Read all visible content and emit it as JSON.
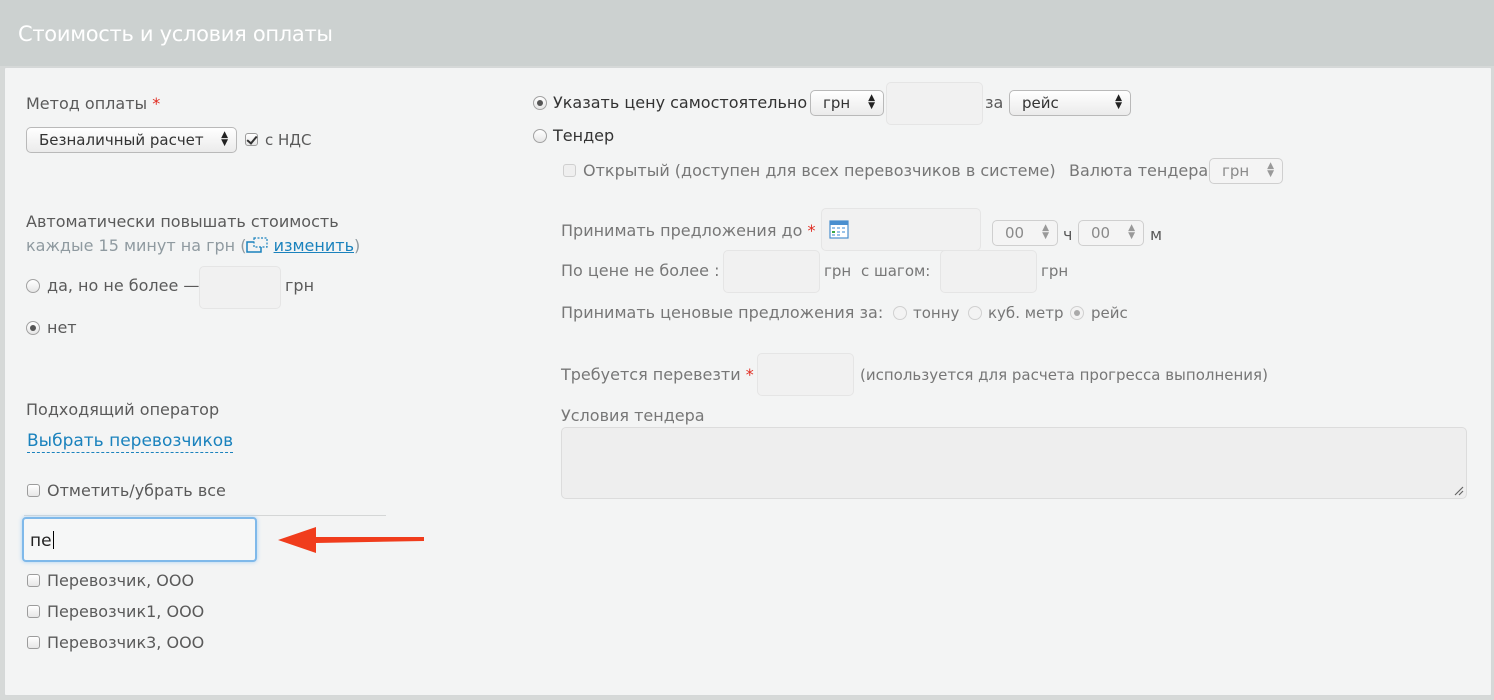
{
  "header": {
    "title": "Стоимость и условия оплаты"
  },
  "payment": {
    "method_label": "Метод оплаты",
    "required_mark": "*",
    "method_value": "Безналичный расчет",
    "vat_label": "с НДС",
    "vat_checked": true
  },
  "auto_raise": {
    "title": "Автоматически повышать стоимость",
    "subtitle_prefix": "каждые 15 минут на грн (",
    "change_link": "изменить",
    "subtitle_suffix": ")",
    "option_yes_label": "да, но не более —",
    "option_yes_unit": "грн",
    "option_no_label": "нет",
    "selected": "no"
  },
  "operator": {
    "title": "Подходящий оператор",
    "choose_link": "Выбрать перевозчиков",
    "toggle_all_label": "Отметить/убрать все",
    "search_value": "пе",
    "carriers": [
      "Перевозчик, ООО",
      "Перевозчик1, ООО",
      "Перевозчик3, ООО"
    ]
  },
  "pricing": {
    "own_price_label": "Указать цену самостоятельно",
    "currency_value": "грн",
    "per_label": "за",
    "per_value": "рейс",
    "tender_label": "Тендер",
    "selected": "own_price",
    "open_label": "Открытый (доступен для всех перевозчиков в системе)",
    "tender_currency_label": "Валюта тендера",
    "tender_currency_value": "грн",
    "accept_until_label": "Принимать предложения до",
    "hours_value": "00",
    "hours_unit": "ч",
    "minutes_value": "00",
    "minutes_unit": "м",
    "max_price_label": "По цене не более :",
    "max_price_unit": "грн",
    "step_label": "с шагом:",
    "step_unit": "грн",
    "accept_per_label": "Принимать ценовые предложения за:",
    "accept_per_options": [
      "тонну",
      "куб. метр",
      "рейс"
    ],
    "accept_per_selected": "рейс",
    "required_transport_label": "Требуется перевезти",
    "required_transport_note": "(используется для расчета прогресса выполнения)",
    "conditions_label": "Условия тендера"
  },
  "colors": {
    "accent_link": "#1a82bd",
    "required": "#e02b20",
    "arrow": "#f03c1c"
  }
}
